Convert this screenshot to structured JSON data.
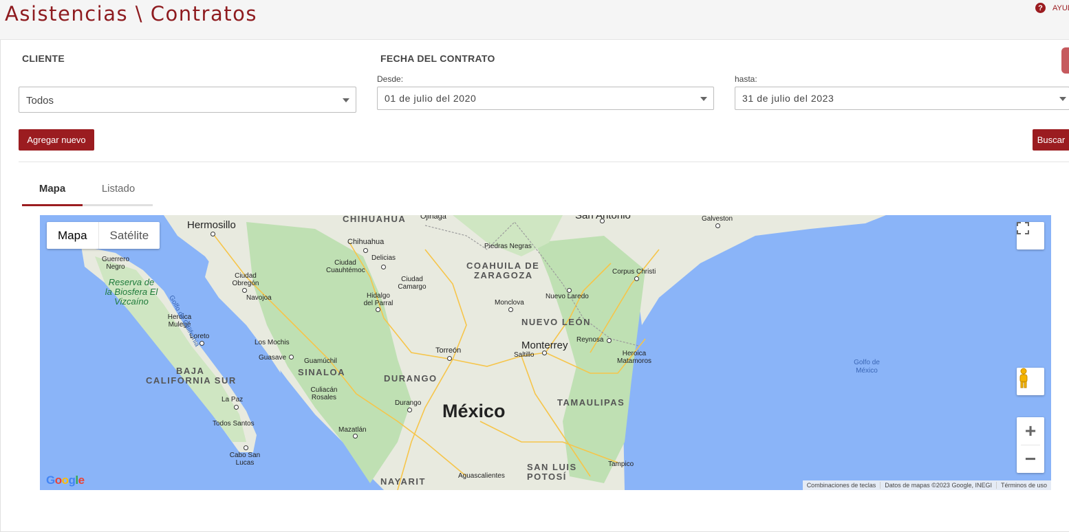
{
  "header": {
    "title": "Asistencias \\ Contratos",
    "help_label": "AYUDA"
  },
  "filters": {
    "client_label": "CLIENTE",
    "client_value": "Todos",
    "date_label": "FECHA DEL CONTRATO",
    "from_label": "Desde:",
    "from_value": "01 de julio del  2020",
    "to_label": "hasta:",
    "to_value": "31 de julio del  2023"
  },
  "actions": {
    "add_label": "Agregar nuevo",
    "search_label": "Buscar"
  },
  "tabs": [
    {
      "label": "Mapa",
      "active": true
    },
    {
      "label": "Listado",
      "active": false
    }
  ],
  "map": {
    "type_options": [
      "Mapa",
      "Satélite"
    ],
    "country": "México",
    "states": [
      "CHIHUAHUA",
      "COAHUILA DE",
      "ZARAGOZA",
      "NUEVO LEÓN",
      "SINALOA",
      "DURANGO",
      "TAMAULIPAS",
      "BAJA",
      "CALIFORNIA SUR",
      "SAN LUIS",
      "POTOSÍ",
      "NAYARIT"
    ],
    "cities": [
      "Hermosillo",
      "Chihuahua",
      "Ojinaga",
      "San Antonio",
      "Galveston",
      "Guerrero Negro",
      "Ciudad Obregón",
      "Navojoa",
      "Ciudad Cuauhtémoc",
      "Delicias",
      "Ciudad Camargo",
      "Hidalgo del Parral",
      "Piedras Negras",
      "Monclova",
      "Nuevo Laredo",
      "Corpus Christi",
      "Heroica Mulegé",
      "Loreto",
      "Los Mochis",
      "Guasave",
      "Guamúchil",
      "Culiacán Rosales",
      "Torreón",
      "Saltillo",
      "Monterrey",
      "Reynosa",
      "Heroica Matamoros",
      "La Paz",
      "Todos Santos",
      "Cabo San Lucas",
      "Durango",
      "Mazatlán",
      "Aguascalientes",
      "Tampico"
    ],
    "water": [
      "Golfo de California",
      "Golfo de México"
    ],
    "reserve": "Reserva de la Biosfera El Vizcaíno",
    "attribution": [
      "Combinaciones de teclas",
      "Datos de mapas ©2023 Google, INEGI",
      "Términos de uso"
    ],
    "logo": "Google",
    "colors": {
      "water": "#8ab4f8",
      "land": "#e8eadf",
      "green": "#bfe0b3",
      "roads": "#f6c54a",
      "accent": "#9b1c20"
    }
  }
}
